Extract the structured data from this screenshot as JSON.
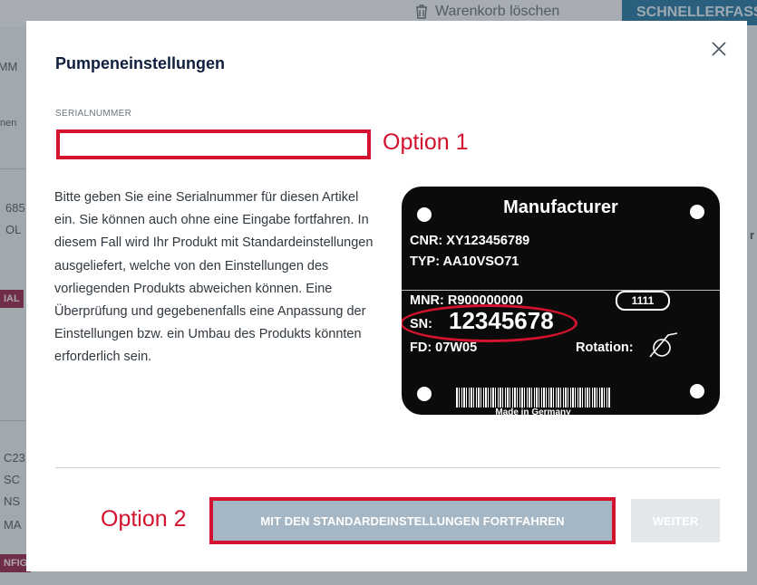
{
  "background": {
    "clear_cart_label": "Warenkorb löschen",
    "quick_button_label": "SCHNELLERFASSUNG",
    "fragments": [
      "IMM",
      "nen",
      "685",
      "OL",
      "IAL",
      "C23",
      "SC",
      "NS",
      "MA",
      "NFIG",
      "r"
    ]
  },
  "modal": {
    "title": "Pumpeneinstellungen",
    "serial_label": "SERIALNUMMER",
    "serial_value": "",
    "serial_placeholder": "",
    "annotation_1": "Option 1",
    "annotation_2": "Option 2",
    "description": "Bitte geben Sie eine Serialnummer für diesen Artikel ein. Sie können auch ohne eine Eingabe fortfahren. In diesem Fall wird Ihr Produkt mit Standardeinstellungen ausgeliefert, welche von den Einstellungen des vorliegenden Produkts abweichen können. Eine Überprüfung und gegebenenfalls eine Anpassung der Einstellungen bzw. ein Umbau des Produkts könnten erforderlich sein.",
    "nameplate": {
      "manufacturer": "Manufacturer",
      "cnr": "CNR: XY123456789",
      "typ": "TYP:  AA10VSO71",
      "mnr": "MNR: R900000000",
      "mnr_box": "1111",
      "sn_label": "SN:",
      "sn_value": "12345678",
      "fd": "FD:   07W05",
      "rotation": "Rotation:",
      "made_in": "Made in Germany"
    },
    "std_button_label": "MIT DEN STANDARDEINSTELLUNGEN FORTFAHREN",
    "next_button_label": "WEITER",
    "accent_red": "#d3122e",
    "title_color": "#0f1f3d"
  }
}
